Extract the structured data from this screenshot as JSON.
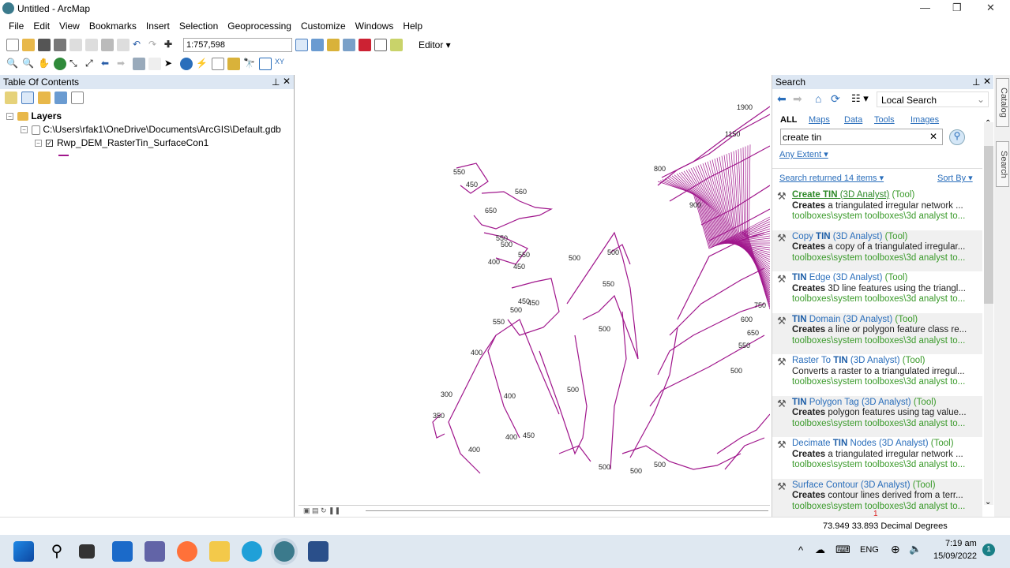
{
  "window": {
    "title": "Untitled - ArcMap",
    "min": "—",
    "max": "❐",
    "close": "✕"
  },
  "menu": [
    "File",
    "Edit",
    "View",
    "Bookmarks",
    "Insert",
    "Selection",
    "Geoprocessing",
    "Customize",
    "Windows",
    "Help"
  ],
  "toolbar": {
    "scale": "1:757,598",
    "editor": "Editor ▾"
  },
  "toc": {
    "title": "Table Of Contents",
    "layers": "Layers",
    "gdb": "C:\\Users\\rfak1\\OneDrive\\Documents\\ArcGIS\\Default.gdb",
    "layer": "Rwp_DEM_RasterTin_SurfaceCon1"
  },
  "map": {
    "labels": [
      "550",
      "450",
      "650",
      "560",
      "400",
      "500",
      "550",
      "550",
      "450",
      "500",
      "500",
      "550",
      "450",
      "500",
      "450",
      "550",
      "500",
      "400",
      "350",
      "300",
      "400",
      "400",
      "450",
      "500",
      "500",
      "500",
      "500",
      "400",
      "1900",
      "800",
      "1150",
      "900",
      "750",
      "650",
      "550",
      "500",
      "600"
    ]
  },
  "search": {
    "title": "Search",
    "scope": "Local Search",
    "tabs": {
      "all": "ALL",
      "maps": "Maps",
      "data": "Data",
      "tools": "Tools",
      "images": "Images"
    },
    "query": "create tin",
    "extent": "Any Extent ▾",
    "count": "Search returned 14 items ▾",
    "sort": "Sort By ▾",
    "results": [
      {
        "pre": "",
        "bold": "Create TIN",
        "post": " (3D Analyst)",
        "tool": " (Tool)",
        "desc_b": "Creates",
        "desc": " a triangulated irregular network ...",
        "path": "toolboxes\\system toolboxes\\3d analyst to..."
      },
      {
        "pre": "Copy ",
        "bold": "TIN",
        "post": " (3D Analyst)",
        "tool": " (Tool)",
        "desc_b": "Creates",
        "desc": " a copy of a triangulated irregular...",
        "path": "toolboxes\\system toolboxes\\3d analyst to..."
      },
      {
        "pre": "",
        "bold": "TIN",
        "post": " Edge (3D Analyst)",
        "tool": " (Tool)",
        "desc_b": "Creates",
        "desc": " 3D line features using the triangl...",
        "path": "toolboxes\\system toolboxes\\3d analyst to..."
      },
      {
        "pre": "",
        "bold": "TIN",
        "post": " Domain (3D Analyst)",
        "tool": " (Tool)",
        "desc_b": "Creates",
        "desc": " a line or polygon feature class re...",
        "path": "toolboxes\\system toolboxes\\3d analyst to..."
      },
      {
        "pre": "Raster To ",
        "bold": "TIN",
        "post": " (3D Analyst)",
        "tool": " (Tool)",
        "desc_b": "",
        "desc": "Converts a raster to a triangulated irregul...",
        "path": "toolboxes\\system toolboxes\\3d analyst to..."
      },
      {
        "pre": "",
        "bold": "TIN",
        "post": " Polygon Tag (3D Analyst)",
        "tool": " (Tool)",
        "desc_b": "Creates",
        "desc": " polygon features using tag value...",
        "path": "toolboxes\\system toolboxes\\3d analyst to..."
      },
      {
        "pre": "Decimate ",
        "bold": "TIN",
        "post": " Nodes (3D Analyst)",
        "tool": " (Tool)",
        "desc_b": "Creates",
        "desc": " a triangulated irregular network ...",
        "path": "toolboxes\\system toolboxes\\3d analyst to..."
      },
      {
        "pre": "Surface Contour (3D Analyst)",
        "bold": "",
        "post": "",
        "tool": " (Tool)",
        "desc_b": "Creates",
        "desc": " contour lines derived from a terr...",
        "path": "toolboxes\\system toolboxes\\3d analyst to..."
      }
    ],
    "side_tabs": {
      "catalog": "Catalog",
      "search": "Search"
    }
  },
  "status": {
    "page": "1",
    "coords": "73.949  33.893 Decimal Degrees"
  },
  "taskbar": {
    "lang": "ENG",
    "time": "7:19 am",
    "date": "15/09/2022",
    "badge": "1"
  },
  "colors": {
    "contour": "#a0168c",
    "link": "#2a6ebb",
    "path": "#3a9a2a"
  }
}
